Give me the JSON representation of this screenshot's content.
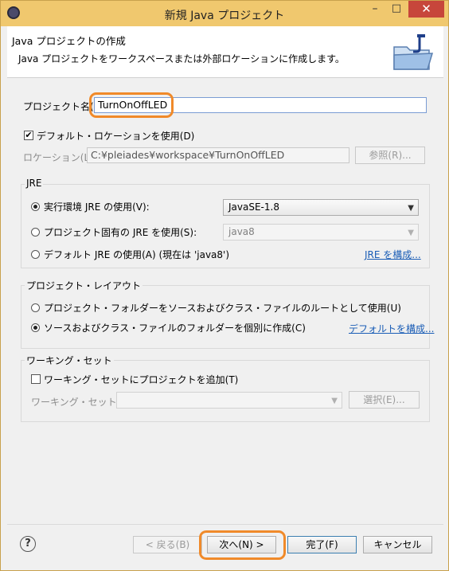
{
  "window": {
    "title": "新規 Java プロジェクト"
  },
  "header": {
    "title": "Java プロジェクトの作成",
    "description": "Java プロジェクトをワークスペースまたは外部ロケーションに作成します。"
  },
  "project": {
    "name_label": "プロジェクト名(P):",
    "name_value": "TurnOnOffLED",
    "default_location_label": "デフォルト・ロケーションを使用(D)",
    "default_location_checked": true,
    "location_label": "ロケーション(L):",
    "location_value": "C:¥pleiades¥workspace¥TurnOnOffLED",
    "browse_label": "参照(R)..."
  },
  "jre": {
    "group_title": "JRE",
    "option_exec_env": "実行環境 JRE の使用(V):",
    "exec_env_value": "JavaSE-1.8",
    "option_project_specific": "プロジェクト固有の JRE を使用(S):",
    "project_specific_value": "java8",
    "option_default": "デフォルト JRE の使用(A) (現在は 'java8')",
    "configure_link": "JRE を構成...",
    "selected": "exec_env"
  },
  "layout": {
    "group_title": "プロジェクト・レイアウト",
    "option_root": "プロジェクト・フォルダーをソースおよびクラス・ファイルのルートとして使用(U)",
    "option_separate": "ソースおよびクラス・ファイルのフォルダーを個別に作成(C)",
    "configure_link": "デフォルトを構成...",
    "selected": "separate"
  },
  "working_set": {
    "group_title": "ワーキング・セット",
    "add_label": "ワーキング・セットにプロジェクトを追加(T)",
    "add_checked": false,
    "sets_label": "ワーキング・セット(O):",
    "select_label": "選択(E)..."
  },
  "footer": {
    "back_label": "< 戻る(B)",
    "next_label": "次へ(N) >",
    "finish_label": "完了(F)",
    "cancel_label": "キャンセル"
  },
  "icons": {
    "app": "eclipse-icon",
    "banner": "java-folder-icon",
    "help": "help-icon"
  },
  "colors": {
    "highlight": "#f08a2a",
    "titlebar": "#f0c86e",
    "close": "#c7463b",
    "link": "#1a5db6"
  }
}
